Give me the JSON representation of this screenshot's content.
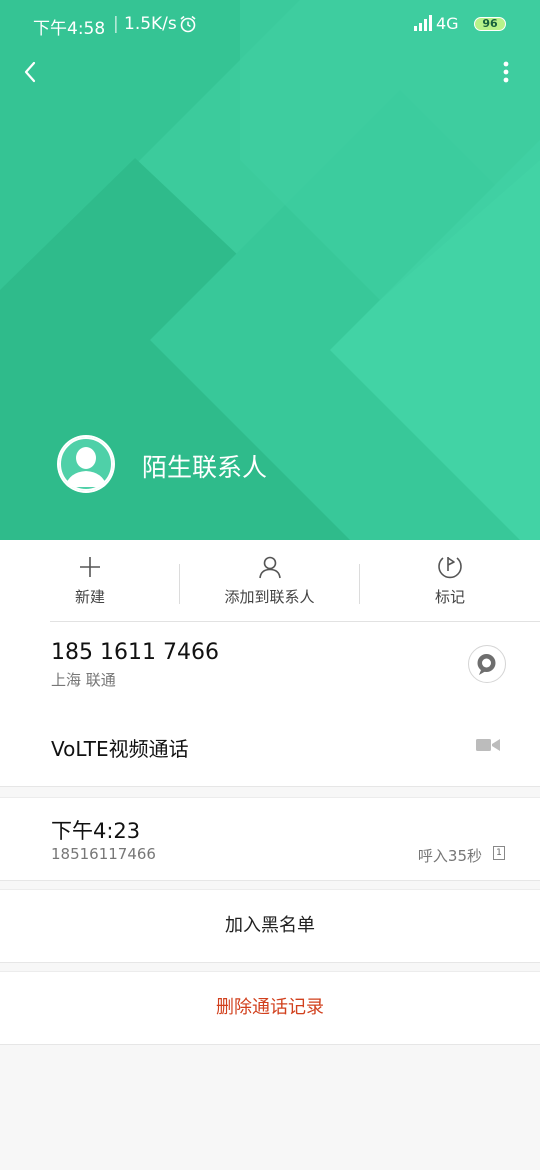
{
  "status_bar": {
    "time": "下午4:58",
    "separator": "|",
    "net_speed": "1.5K/s",
    "network": "4G",
    "battery": "96"
  },
  "contact": {
    "name": "陌生联系人"
  },
  "actions": [
    {
      "label": "新建",
      "icon": "plus-icon"
    },
    {
      "label": "添加到联系人",
      "icon": "person-icon"
    },
    {
      "label": "标记",
      "icon": "flag-icon"
    }
  ],
  "phone": {
    "number": "185 1611 7466",
    "location": "上海 联通",
    "volte_label": "VoLTE视频通话"
  },
  "call_log": {
    "time": "下午4:23",
    "number": "18516117466",
    "info": "呼入35秒",
    "sim": "1"
  },
  "buttons": {
    "blacklist": "加入黑名单",
    "delete": "删除通话记录"
  },
  "colors": {
    "header_green": "#3ccb9c",
    "delete_red": "#d1401d"
  }
}
